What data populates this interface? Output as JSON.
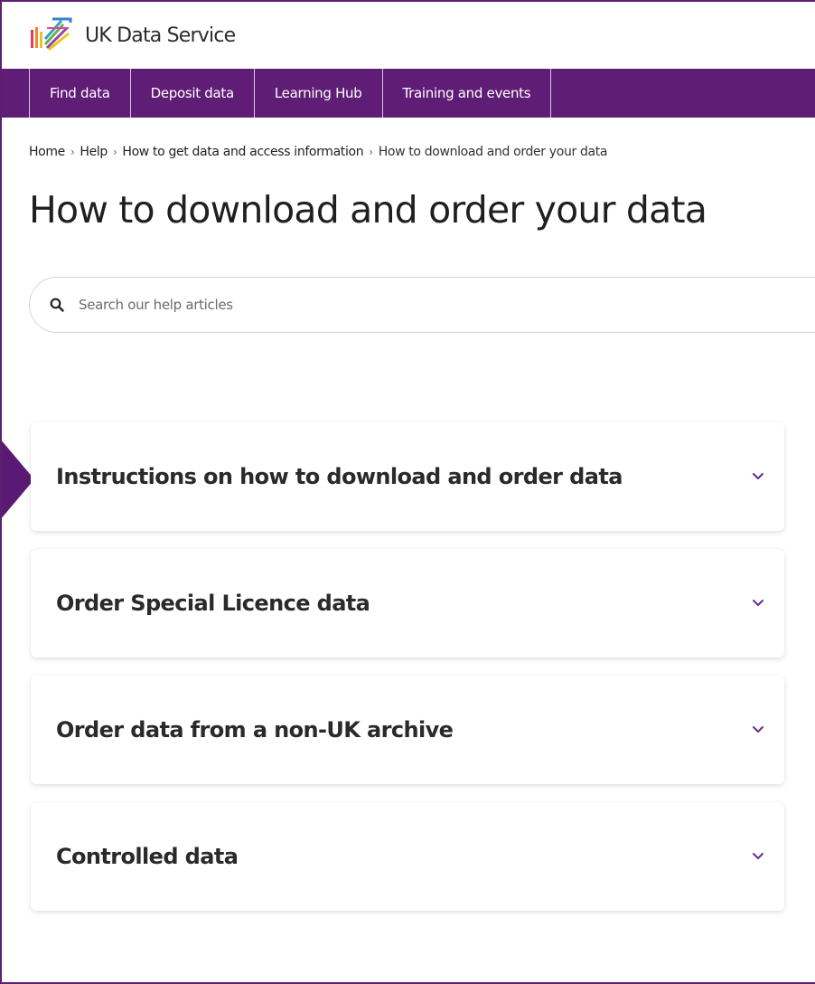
{
  "brand": {
    "name": "UK Data Service"
  },
  "nav": {
    "items": [
      {
        "label": "Find data"
      },
      {
        "label": "Deposit data"
      },
      {
        "label": "Learning Hub"
      },
      {
        "label": "Training and events"
      }
    ]
  },
  "breadcrumb": {
    "items": [
      {
        "label": "Home"
      },
      {
        "label": "Help"
      },
      {
        "label": "How to get data and access information"
      }
    ],
    "current": "How to download and order your data",
    "separator": "›"
  },
  "page": {
    "title": "How to download and order your data"
  },
  "search": {
    "placeholder": "Search our help articles",
    "value": ""
  },
  "accordion": {
    "items": [
      {
        "title": "Instructions on how to download and order data"
      },
      {
        "title": "Order Special Licence data"
      },
      {
        "title": "Order data from a non-UK archive"
      },
      {
        "title": "Controlled data"
      }
    ]
  },
  "colors": {
    "brand_purple": "#5f1d76",
    "chevron": "#6a2b85",
    "pointer": "#5a1a73"
  },
  "icons": {
    "search": "search-icon",
    "chevron": "chevron-down-icon",
    "logo": "uk-data-service-logo-icon",
    "pointer": "pointer-arrow-icon"
  }
}
